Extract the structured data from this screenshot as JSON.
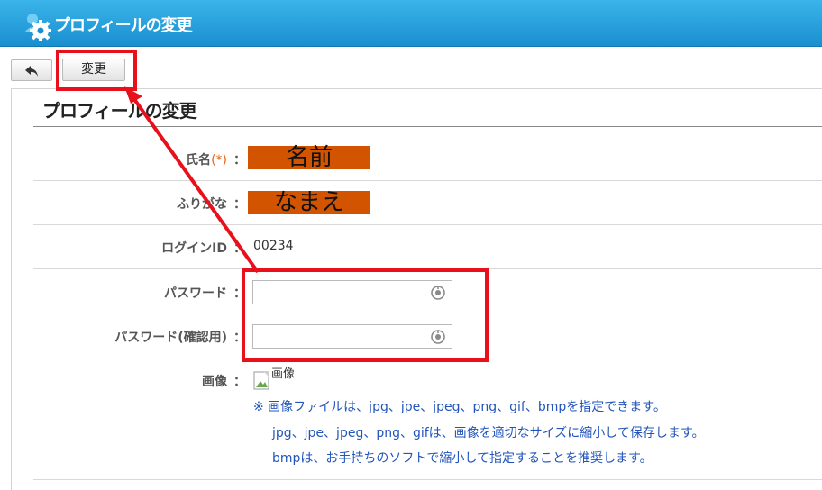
{
  "header": {
    "title": "プロフィールの変更"
  },
  "toolbar": {
    "back_icon": "back-arrow-icon",
    "change_label": "変更"
  },
  "form": {
    "section_title": "プロフィールの変更",
    "name": {
      "label": "氏名",
      "required_mark": "(*)",
      "colon": "：",
      "value": "名前"
    },
    "furigana": {
      "label": "ふりがな",
      "colon": "：",
      "value": "なまえ"
    },
    "login_id": {
      "label": "ログインID",
      "colon": "：",
      "value": "00234"
    },
    "password": {
      "label": "パスワード",
      "colon": "：",
      "value": ""
    },
    "password_confirm": {
      "label": "パスワード(確認用)",
      "colon": "：",
      "value": ""
    },
    "image": {
      "label": "画像",
      "colon": "：",
      "alt_text": "画像",
      "notes": [
        "※ 画像ファイルは、jpg、jpe、jpeg、png、gif、bmpを指定できます。",
        "jpg、jpe、jpeg、png、gifは、画像を適切なサイズに縮小して保存します。",
        "bmpは、お手持ちのソフトで縮小して指定することを推奨します。"
      ]
    }
  },
  "colors": {
    "header_blue": "#1a8fd0",
    "annotation_red": "#e8101a",
    "redaction_orange": "#d35400",
    "note_blue": "#2255bb"
  }
}
